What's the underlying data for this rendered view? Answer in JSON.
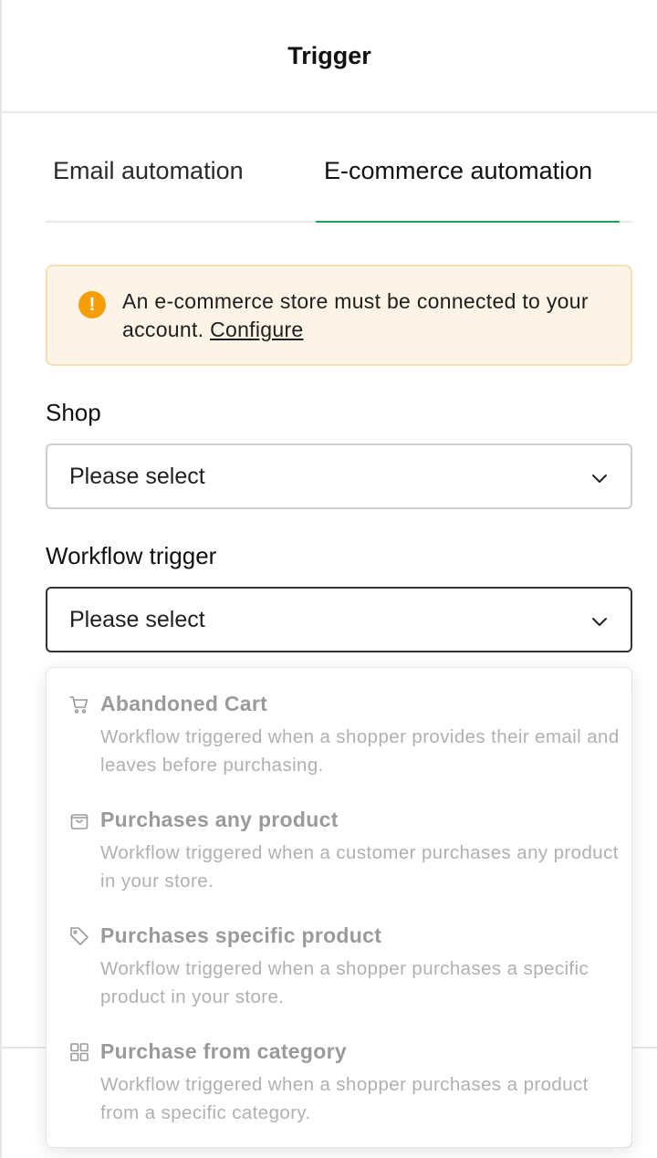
{
  "header": {
    "title": "Trigger"
  },
  "tabs": [
    {
      "label": "Email automation",
      "active": false
    },
    {
      "label": "E-commerce automation",
      "active": true
    }
  ],
  "alert": {
    "icon": "warning-icon",
    "message": "An e-commerce store must be connected to your account.",
    "link_label": "Configure"
  },
  "shop": {
    "label": "Shop",
    "value": "Please select"
  },
  "workflow_trigger": {
    "label": "Workflow trigger",
    "value": "Please select"
  },
  "options": [
    {
      "icon": "cart-icon",
      "title": "Abandoned Cart",
      "description": "Workflow triggered when a shopper provides their email and leaves before purchasing."
    },
    {
      "icon": "shopping-bag-icon",
      "title": "Purchases any product",
      "description": "Workflow triggered when a customer purchases any product in your store."
    },
    {
      "icon": "tag-icon",
      "title": "Purchases specific product",
      "description": "Workflow triggered when a shopper purchases a specific product in your store."
    },
    {
      "icon": "category-grid-icon",
      "title": "Purchase from category",
      "description": "Workflow triggered when a shopper purchases a product from a specific category."
    }
  ],
  "colors": {
    "accent": "#1fa55b",
    "warning": "#f59e0b",
    "alert_bg": "#fdf4e7"
  }
}
